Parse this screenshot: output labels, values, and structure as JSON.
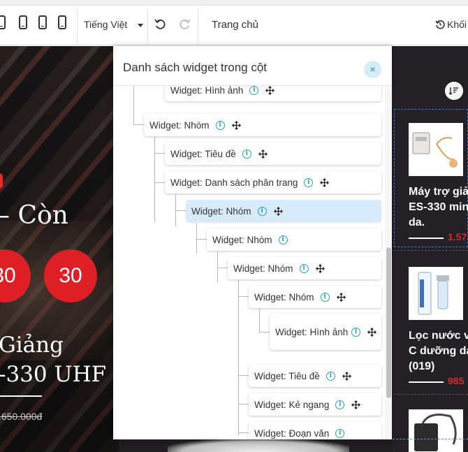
{
  "toolbar": {
    "language": "Tiếng Việt",
    "page": "Trang chủ",
    "blocks_label": "Khối"
  },
  "hero": {
    "title": "– Còn",
    "countdown": [
      "30",
      "30"
    ],
    "subtitle_line1": "Giảng",
    "subtitle_line2": "-330 UHF",
    "old_price": ".650.000đ"
  },
  "products": [
    {
      "name_lines": [
        "Máy trợ giả",
        "ES-330 min",
        "da."
      ],
      "price": "1.57"
    },
    {
      "name_lines": [
        "Lọc nước v",
        "C dưỡng da",
        "(019)"
      ],
      "price": "985"
    }
  ],
  "dialog": {
    "title": "Danh sách widget trong cột",
    "close_label": "×",
    "nodes": [
      {
        "label": "Widget: Hình ảnh",
        "move": true
      },
      {
        "label": "Widget: Nhóm",
        "move": true
      },
      {
        "label": "Widget: Tiêu đề",
        "move": true
      },
      {
        "label": "Widget: Danh sách phân trang",
        "move": true
      },
      {
        "label": "Widget: Nhóm",
        "move": true,
        "selected": true
      },
      {
        "label": "Widget: Nhóm",
        "move": false
      },
      {
        "label": "Widget: Nhóm",
        "move": true
      },
      {
        "label": "Widget: Nhóm",
        "move": true
      },
      {
        "label": "Widget: Hình ảnh",
        "move": true
      },
      {
        "label": "Widget: Tiêu đề",
        "move": true
      },
      {
        "label": "Widget: Kẻ ngang",
        "move": true
      },
      {
        "label": "Widget: Đoạn văn",
        "move": false
      }
    ]
  },
  "colors": {
    "accent_red": "#de1f26",
    "selected_node": "#d8ebfb",
    "info_icon": "#27a2b8"
  }
}
